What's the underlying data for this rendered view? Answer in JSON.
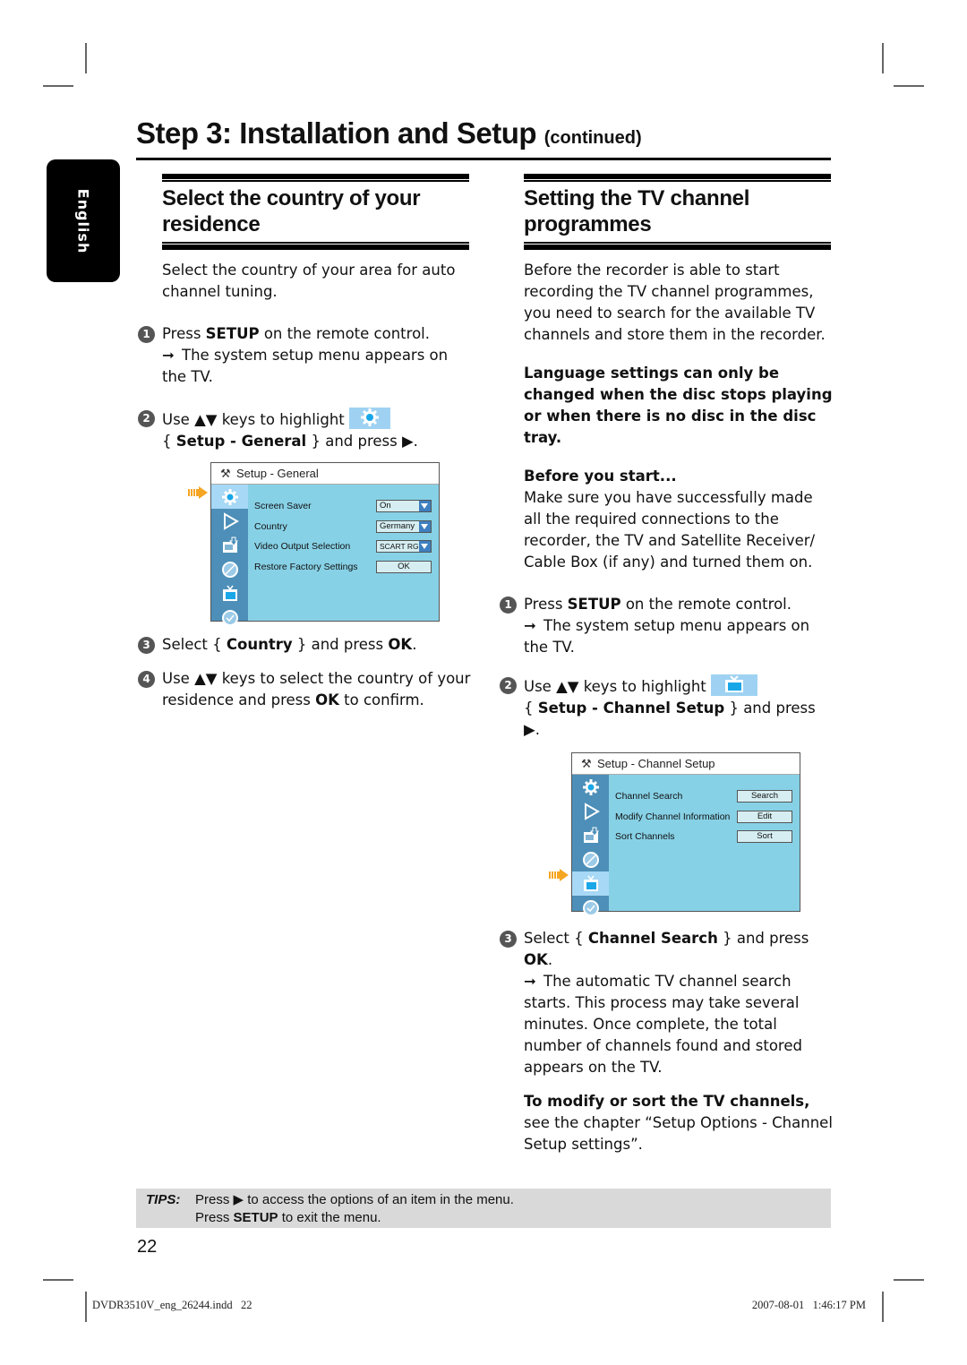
{
  "side_tab": {
    "language": "English"
  },
  "header": {
    "title": "Step 3: Installation and Setup",
    "continued": "(continued)"
  },
  "left": {
    "heading_line1": "Select the country of your",
    "heading_line2": "residence",
    "intro": "Select the country of your area for auto channel tuning.",
    "steps": [
      {
        "num": "1",
        "pre": "Press ",
        "bold": "SETUP",
        "post": " on the remote control.",
        "result": "The system setup menu appears on the TV."
      },
      {
        "num": "2",
        "pre": "Use ▲▼ keys to highlight",
        "bold": "Setup - General",
        "post": " } and press ▶."
      },
      {
        "num": "3",
        "pre": "Select { ",
        "bold": "Country",
        "mid": " } and press ",
        "bold2": "OK",
        "post": "."
      },
      {
        "num": "4",
        "pre": "Use ▲▼ keys to select the country of your residence and press ",
        "bold": "OK",
        "post": " to confirm."
      }
    ],
    "highlight_icon": "gear-icon",
    "menu": {
      "title": "Setup - General",
      "title_icon": "tools-icon",
      "side_icons": [
        "gear-icon",
        "play-icon",
        "record-icon",
        "disc-icon",
        "tv-icon",
        "clock-icon"
      ],
      "selected_index": 0,
      "rows": [
        {
          "label": "Screen Saver",
          "value": "On",
          "type": "dropdown"
        },
        {
          "label": "Country",
          "value": "Germany",
          "type": "dropdown"
        },
        {
          "label": "Video Output Selection",
          "value": "SCART RGB",
          "type": "dropdown"
        },
        {
          "label": "Restore Factory Settings",
          "value": "OK",
          "type": "button"
        }
      ]
    }
  },
  "right": {
    "heading_line1": "Setting the TV channel",
    "heading_line2": "programmes",
    "intro": "Before the recorder is able to start recording the TV channel programmes, you need to search for the available TV channels and store them in the recorder.",
    "warning": "Language settings can only be changed when the disc stops playing or when there is no disc in the disc tray.",
    "before_title": "Before you start...",
    "before_text": "Make sure you have successfully made all the required connections to the recorder, the TV and Satellite Receiver/ Cable Box (if any) and turned them on.",
    "steps": [
      {
        "num": "1",
        "pre": "Press ",
        "bold": "SETUP",
        "post": " on the remote control.",
        "result": "The system setup menu appears on the TV."
      },
      {
        "num": "2",
        "pre": "Use ▲▼ keys to highlight",
        "bold": "Setup - Channel Setup",
        "post": " } and press ▶."
      },
      {
        "num": "3",
        "pre": "Select { ",
        "bold": "Channel Search",
        "mid": " } and press ",
        "bold2": "OK",
        "post": ".",
        "result": "The automatic TV channel search starts. This process may take several minutes. Once complete, the total number of channels found and stored appears on the TV."
      }
    ],
    "highlight_icon": "tv-icon",
    "menu": {
      "title": "Setup - Channel Setup",
      "title_icon": "tools-icon",
      "side_icons": [
        "gear-icon",
        "play-icon",
        "record-icon",
        "disc-icon",
        "tv-icon",
        "clock-icon"
      ],
      "selected_index": 4,
      "rows": [
        {
          "label": "Channel Search",
          "value": "Search",
          "type": "button"
        },
        {
          "label": "Modify Channel Information",
          "value": "Edit",
          "type": "button"
        },
        {
          "label": "Sort Channels",
          "value": "Sort",
          "type": "button"
        }
      ]
    },
    "note_bold": "To modify or sort the TV channels,",
    "note_text": "see the chapter “Setup Options - Channel Setup settings”."
  },
  "tips": {
    "label": "TIPS:",
    "line1_pre": "Press ",
    "line1_icon": "▶",
    "line1_post": " to access the options of an item in the menu.",
    "line2_pre": "Press ",
    "line2_bold": "SETUP",
    "line2_post": " to exit the menu."
  },
  "page_number": "22",
  "footer": {
    "file": "DVDR3510V_eng_26244.indd   22",
    "timestamp": "2007-08-01   1:46:17 PM"
  },
  "colors": {
    "menu_bg": "#87d1e6",
    "menu_sidebar": "#4d8fb8",
    "menu_selected": "#a7d8f5",
    "pointer": "#f5a623",
    "tips_bg": "#d9d9d9"
  }
}
